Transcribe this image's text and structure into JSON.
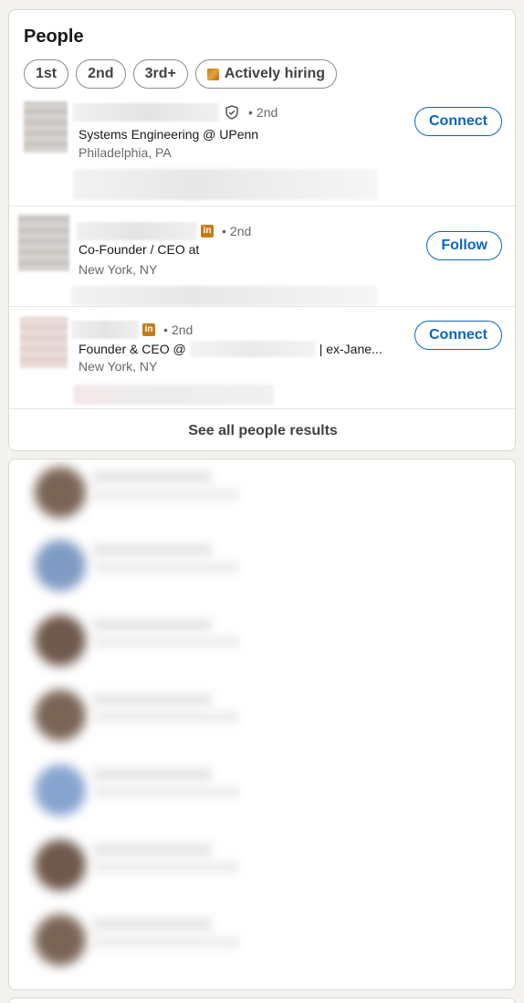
{
  "people": {
    "title": "People",
    "filters": [
      {
        "label": "1st"
      },
      {
        "label": "2nd"
      },
      {
        "label": "3rd+"
      },
      {
        "label": "Actively hiring",
        "icon": "hiring-badge-icon"
      }
    ],
    "results": [
      {
        "degree_sep": "•",
        "degree": "2nd",
        "badge": "verified-shield-icon",
        "headline": "Systems Engineering @ UPenn",
        "location": "Philadelphia, PA",
        "action": "Connect"
      },
      {
        "degree_sep": "•",
        "degree": "2nd",
        "badge": "linkedin-premium-icon",
        "headline": "Co-Founder / CEO at",
        "location": "New York, NY",
        "action": "Follow"
      },
      {
        "degree_sep": "•",
        "degree": "2nd",
        "badge": "linkedin-premium-icon",
        "headline_start": "Founder & CEO @",
        "headline_end": "| ex-Jane...",
        "location": "New York, NY",
        "action": "Connect"
      }
    ],
    "see_all": "See all people results"
  },
  "colors": {
    "accent": "#0a66c2",
    "premium_gold": "#c37d16",
    "page_bg": "#f4f2ee"
  },
  "blurred_items": [
    {
      "avatar_color": "#7a6456"
    },
    {
      "avatar_color": "#7f9bc4"
    },
    {
      "avatar_color": "#6f584c"
    },
    {
      "avatar_color": "#7a6456"
    },
    {
      "avatar_color": "#86a4d0"
    },
    {
      "avatar_color": "#6f584c"
    },
    {
      "avatar_color": "#7a6456"
    }
  ]
}
